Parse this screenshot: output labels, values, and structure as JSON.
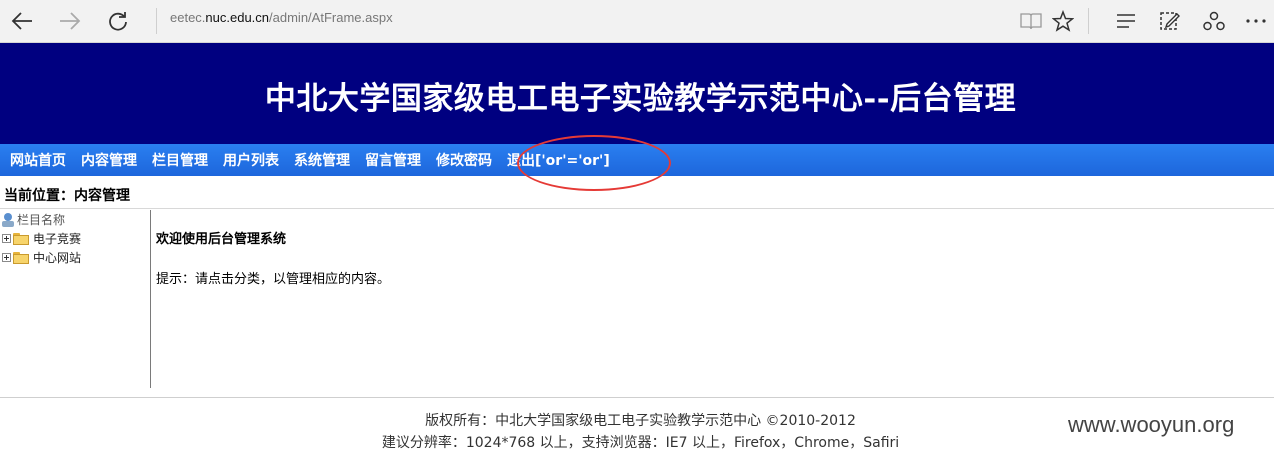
{
  "browser": {
    "address_prefix": "eetec.",
    "address_host": "nuc.edu.cn",
    "address_path": "/admin/AtFrame.aspx"
  },
  "page": {
    "banner_title": "中北大学国家级电工电子实验教学示范中心--后台管理",
    "menu": [
      "网站首页",
      "内容管理",
      "栏目管理",
      "用户列表",
      "系统管理",
      "留言管理",
      "修改密码",
      "退出['or'='or']"
    ],
    "location": "当前位置：内容管理",
    "tree": {
      "header": "栏目名称",
      "items": [
        "电子竞赛",
        "中心网站"
      ]
    },
    "main": {
      "welcome": "欢迎使用后台管理系统",
      "tip": "提示：请点击分类，以管理相应的内容。"
    },
    "footer": {
      "copyright": "版权所有：中北大学国家级电工电子实验教学示范中心 ©2010-2012",
      "resolution": "建议分辨率：1024*768 以上，支持浏览器：IE7 以上，Firefox，Chrome，Safiri"
    },
    "watermark": "www.wooyun.org"
  },
  "colors": {
    "banner": "#000080",
    "menubar": "#1d66dc",
    "annotation_circle": "#e53a36"
  }
}
